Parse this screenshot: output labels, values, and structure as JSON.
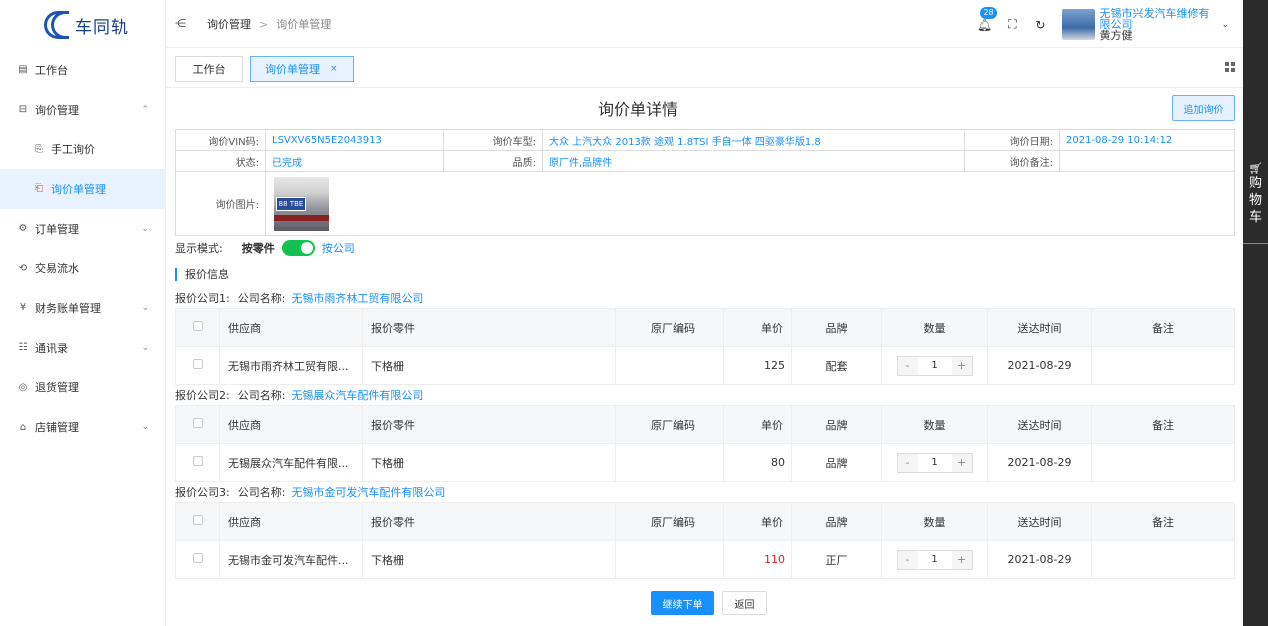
{
  "logo": {
    "text": "车同轨"
  },
  "sidebar": {
    "items": [
      {
        "label": "工作台",
        "icon": "workbench-icon"
      },
      {
        "label": "询价管理",
        "icon": "inquiry-icon",
        "expanded": true
      },
      {
        "label": "手工询价",
        "icon": "manual-inquiry-icon",
        "sub": true
      },
      {
        "label": "询价单管理",
        "icon": "inquiry-list-icon",
        "sub": true,
        "active": true
      },
      {
        "label": "订单管理",
        "icon": "order-icon"
      },
      {
        "label": "交易流水",
        "icon": "transaction-icon"
      },
      {
        "label": "财务账单管理",
        "icon": "finance-icon"
      },
      {
        "label": "通讯录",
        "icon": "contacts-icon"
      },
      {
        "label": "退货管理",
        "icon": "return-icon"
      },
      {
        "label": "店铺管理",
        "icon": "shop-icon"
      }
    ]
  },
  "header": {
    "breadcrumb": [
      "询价管理",
      "询价单管理"
    ],
    "notification_count": "28",
    "shop_name": "无锡市兴发汽车维修有限公司",
    "user_name": "黄方健"
  },
  "tabs": [
    {
      "label": "工作台"
    },
    {
      "label": "询价单管理",
      "close": "×"
    }
  ],
  "cart": {
    "chars": [
      "购",
      "物",
      "车"
    ]
  },
  "main": {
    "title": "询价单详情",
    "add_button": "追加询价",
    "info": {
      "vin_label": "询价VIN码:",
      "vin": "LSVXV65N5E2043913",
      "model_label": "询价车型:",
      "model": "大众 上汽大众 2013款 途观 1.8TSI 手自一体 四驱豪华版1.8",
      "date_label": "询价日期:",
      "date": "2021-08-29 10:14:12",
      "status_label": "状态:",
      "status": "已完成",
      "quality_label": "品质:",
      "quality": "原厂件,品牌件",
      "remark_label": "询价备注:",
      "remark": "",
      "image_label": "询价图片:",
      "plate_text": "88 TBE"
    },
    "display_mode": {
      "label": "显示模式:",
      "by_part": "按零件",
      "by_company": "按公司"
    },
    "section_title": "报价信息",
    "columns": [
      "供应商",
      "报价零件",
      "原厂编码",
      "单价",
      "品牌",
      "数量",
      "送达时间",
      "备注"
    ],
    "quotes": [
      {
        "index_label": "报价公司1:",
        "name_label": "公司名称:",
        "company": "无锡市雨齐林工贸有限公司",
        "row": {
          "supplier": "无锡市雨齐林工贸有限...",
          "part": "下格栅",
          "oem": "",
          "price": "125",
          "brand": "配套",
          "qty": "1",
          "delivery": "2021-08-29",
          "remark": ""
        }
      },
      {
        "index_label": "报价公司2:",
        "name_label": "公司名称:",
        "company": "无锡展众汽车配件有限公司",
        "row": {
          "supplier": "无锡展众汽车配件有限...",
          "part": "下格栅",
          "oem": "",
          "price": "80",
          "brand": "品牌",
          "qty": "1",
          "delivery": "2021-08-29",
          "remark": ""
        }
      },
      {
        "index_label": "报价公司3:",
        "name_label": "公司名称:",
        "company": "无锡市金可发汽车配件有限公司",
        "row": {
          "supplier": "无锡市金可发汽车配件...",
          "part": "下格栅",
          "oem": "",
          "price": "110",
          "brand": "正厂",
          "qty": "1",
          "delivery": "2021-08-29",
          "remark": "",
          "price_highlight": true
        }
      }
    ],
    "stepper": {
      "minus": "-",
      "plus": "+"
    },
    "continue_button": "继续下单",
    "back_button": "返回"
  }
}
